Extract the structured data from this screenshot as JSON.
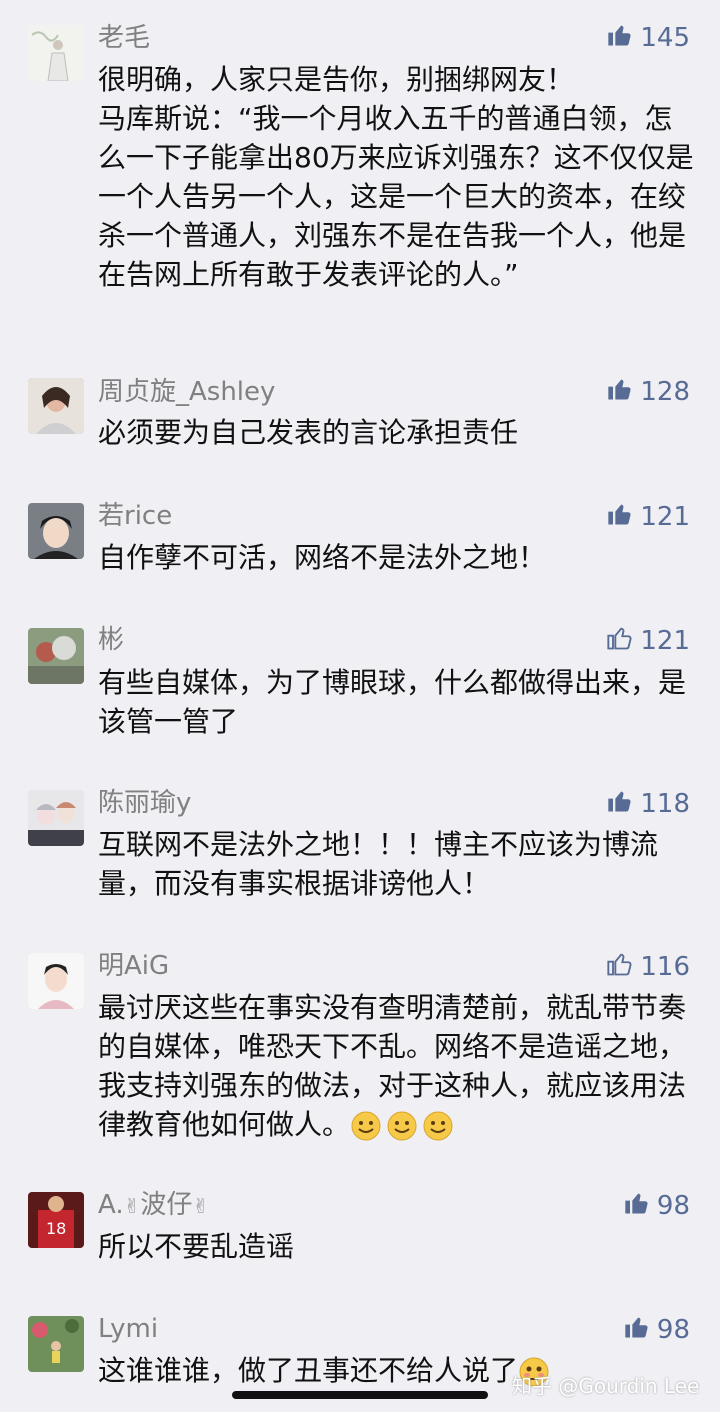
{
  "comments": [
    {
      "name": "老毛",
      "likes": "145",
      "liked": true,
      "text": "很明确，人家只是告你，别捆绑网友！\n马库斯说：“我一个月收入五千的普通白领，怎么一下子能拿出80万来应诉刘强东？这不仅仅是一个人告另一个人，这是一个巨大的资本，在绞杀一个普通人，刘强东不是在告我一个人，他是在告网上所有敢于发表评论的人。”"
    },
    {
      "name": "周贞旋_Ashley",
      "likes": "128",
      "liked": true,
      "text": "必须要为自己发表的言论承担责任"
    },
    {
      "name": "若rice",
      "likes": "121",
      "liked": true,
      "text": "自作孽不可活，网络不是法外之地！"
    },
    {
      "name": "彬",
      "likes": "121",
      "liked": false,
      "text": "有些自媒体，为了博眼球，什么都做得出来，是该管一管了"
    },
    {
      "name": "陈丽瑜y",
      "likes": "118",
      "liked": true,
      "text": "互联网不是法外之地！！！博主不应该为博流量，而没有事实根据诽谤他人！"
    },
    {
      "name": "明AiG",
      "likes": "116",
      "liked": false,
      "text": "最讨厌这些在事实没有查明清楚前，就乱带节奏的自媒体，唯恐天下不乱。网络不是造谣之地，我支持刘强东的做法，对于这种人，就应该用法律教育他如何做人。"
    },
    {
      "name": "A.",
      "name_suffix": "波仔",
      "likes": "98",
      "liked": true,
      "text": "所以不要乱造谣"
    },
    {
      "name": "Lymi",
      "likes": "98",
      "liked": true,
      "text": "这谁谁谁，做了丑事还不给人说了"
    }
  ],
  "watermark": "知乎 @Gourdin Lee",
  "colors": {
    "background": "#efeff4",
    "name": "#808080",
    "like": "#576b95",
    "text": "#111111"
  },
  "icons": {
    "like": "thumbs-up-icon",
    "emoji": "smile-emoji-icon"
  }
}
